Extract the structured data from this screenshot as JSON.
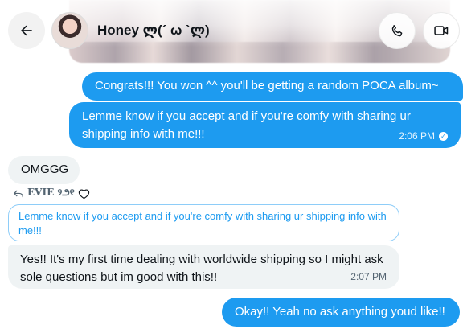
{
  "header": {
    "contact_name": "Honey ლ(´ ω `ლ)",
    "back_icon": "arrow-left-icon",
    "call_icon": "phone-icon",
    "video_icon": "video-camera-icon"
  },
  "messages": {
    "m1": {
      "text": "Congrats!!! You won ^^ you'll be getting a random POCA album~"
    },
    "m2": {
      "text": "Lemme know if you accept and if you're comfy with sharing ur shipping info with me!!!",
      "time": "2:06 PM",
      "status_icon": "read-check-icon"
    },
    "m3": {
      "text": "OMGGG"
    },
    "reply": {
      "author": "𝐄𝐕𝐈𝐄 ୨౨୧",
      "quoted_text": "Lemme know if you accept and if you're comfy with sharing ur shipping info with me!!!"
    },
    "m4": {
      "text": "Yes!! It's my first time dealing with worldwide shipping so I might ask sole questions but im good with this!!",
      "time": "2:07 PM"
    },
    "m5": {
      "text": "Okay!! Yeah no ask anything youd like!!"
    }
  },
  "colors": {
    "accent": "#1d9bf0",
    "received_bubble": "#eff3f4",
    "quote_border": "#8ecdf8"
  }
}
